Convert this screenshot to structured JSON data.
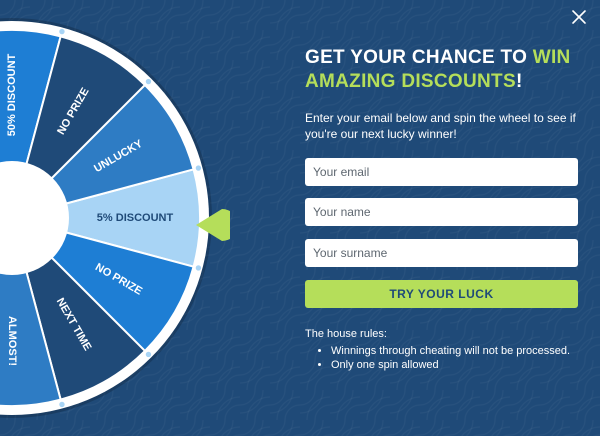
{
  "headline": {
    "part1": "GET YOUR CHANCE TO ",
    "accent1": "WIN",
    "accent2": "AMAZING DISCOUNTS",
    "end": "!"
  },
  "subtext": "Enter your email below and spin the wheel to see if you're our next lucky winner!",
  "form": {
    "email_placeholder": "Your email",
    "name_placeholder": "Your name",
    "surname_placeholder": "Your surname",
    "submit_label": "TRY YOUR LUCK"
  },
  "rules": {
    "title": "The house rules:",
    "items": [
      "Winnings through cheating will not be processed.",
      "Only one spin allowed"
    ]
  },
  "wheel": {
    "segments": [
      {
        "label": "5% DISCOUNT",
        "color": "#a8d4f5",
        "text_color": "#1f4a78"
      },
      {
        "label": "NO PRIZE",
        "color": "#1e7ed4",
        "text_color": "#ffffff"
      },
      {
        "label": "NEXT TIME",
        "color": "#1f4a78",
        "text_color": "#ffffff"
      },
      {
        "label": "ALMOST!",
        "color": "#2e7cc4",
        "text_color": "#ffffff"
      },
      {
        "label": "",
        "color": "#a8d4f5",
        "text_color": "#1f4a78"
      },
      {
        "label": "",
        "color": "#1e7ed4",
        "text_color": "#ffffff"
      },
      {
        "label": "",
        "color": "#1f4a78",
        "text_color": "#ffffff"
      },
      {
        "label": "",
        "color": "#2e7cc4",
        "text_color": "#ffffff"
      },
      {
        "label": "",
        "color": "#a8d4f5",
        "text_color": "#1f4a78"
      },
      {
        "label": "50% DISCOUNT",
        "color": "#1e7ed4",
        "text_color": "#ffffff"
      },
      {
        "label": "NO PRIZE",
        "color": "#1f4a78",
        "text_color": "#ffffff"
      },
      {
        "label": "UNLUCKY",
        "color": "#2e7cc4",
        "text_color": "#ffffff"
      }
    ],
    "rim_color": "#ffffff",
    "pointer_color": "#b5de5a",
    "peg_color": "#a8d4f5"
  },
  "colors": {
    "background": "#1f4a78",
    "accent": "#b5de5a",
    "text": "#ffffff"
  },
  "icons": {
    "close": "close-icon",
    "pointer": "wheel-pointer-icon"
  }
}
